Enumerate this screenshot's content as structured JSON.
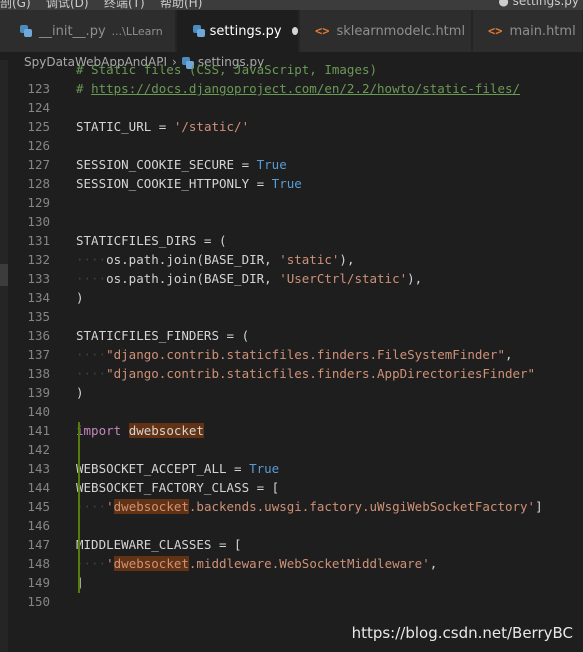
{
  "menu": {
    "items": [
      "剖(G)",
      "调试(D)",
      "终端(T)",
      "帮助(H)"
    ],
    "title": "● settings.py"
  },
  "tabs": [
    {
      "label": "__init__.py",
      "hint": "...\\LLearn",
      "icon": "python-icon",
      "active": false
    },
    {
      "label": "settings.py",
      "hint": "",
      "icon": "python-icon",
      "active": true,
      "modified": true
    },
    {
      "label": "sklearnmodelc.html",
      "hint": "",
      "icon": "html-icon",
      "active": false
    },
    {
      "label": "main.html",
      "hint": "",
      "icon": "html-icon",
      "active": false
    }
  ],
  "breadcrumb": {
    "folder": "SpyDataWebAppAndAPI",
    "file": "settings.py"
  },
  "editor": {
    "lines": [
      {
        "n": "",
        "t": "# Static files (CSS, JavaScript, Images)"
      },
      {
        "n": "123",
        "t": "# https://docs.djangoproject.com/en/2.2/howto/static-files/"
      },
      {
        "n": "124",
        "t": ""
      },
      {
        "n": "125",
        "t": "STATIC_URL = '/static/'"
      },
      {
        "n": "126",
        "t": ""
      },
      {
        "n": "127",
        "t": "SESSION_COOKIE_SECURE = True"
      },
      {
        "n": "128",
        "t": "SESSION_COOKIE_HTTPONLY = True"
      },
      {
        "n": "129",
        "t": ""
      },
      {
        "n": "130",
        "t": ""
      },
      {
        "n": "131",
        "t": "STATICFILES_DIRS = ("
      },
      {
        "n": "132",
        "t": "    os.path.join(BASE_DIR, 'static'),"
      },
      {
        "n": "133",
        "t": "    os.path.join(BASE_DIR, 'UserCtrl/static'),"
      },
      {
        "n": "134",
        "t": ")"
      },
      {
        "n": "135",
        "t": ""
      },
      {
        "n": "136",
        "t": "STATICFILES_FINDERS = ("
      },
      {
        "n": "137",
        "t": "    \"django.contrib.staticfiles.finders.FileSystemFinder\","
      },
      {
        "n": "138",
        "t": "    \"django.contrib.staticfiles.finders.AppDirectoriesFinder\""
      },
      {
        "n": "139",
        "t": ")"
      },
      {
        "n": "140",
        "t": ""
      },
      {
        "n": "141",
        "t": "import dwebsocket"
      },
      {
        "n": "142",
        "t": ""
      },
      {
        "n": "143",
        "t": "WEBSOCKET_ACCEPT_ALL = True"
      },
      {
        "n": "144",
        "t": "WEBSOCKET_FACTORY_CLASS = ["
      },
      {
        "n": "145",
        "t": "    'dwebsocket.backends.uwsgi.factory.uWsgiWebSocketFactory']"
      },
      {
        "n": "146",
        "t": ""
      },
      {
        "n": "147",
        "t": "MIDDLEWARE_CLASSES = ["
      },
      {
        "n": "148",
        "t": "    'dwebsocket.middleware.WebSocketMiddleware',"
      },
      {
        "n": "149",
        "t": "]"
      },
      {
        "n": "150",
        "t": ""
      }
    ]
  },
  "watermark": "https://blog.csdn.net/BerryBC",
  "colors": {
    "background": "#1e1e1e",
    "keyword": "#569cd6",
    "string": "#ce9178",
    "comment": "#6a9955",
    "import": "#c586c0",
    "highlight": "#613214",
    "gutter_added": "#587c0c"
  }
}
